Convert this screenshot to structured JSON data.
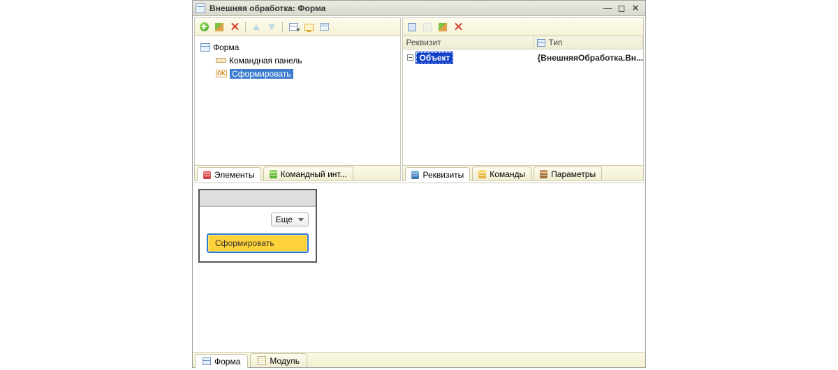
{
  "window": {
    "title": "Внешняя обработка: Форма"
  },
  "left_pane": {
    "tree": {
      "root": "Форма",
      "cmd_panel": "Командная панель",
      "generate": "Сформировать"
    },
    "tabs": {
      "elements": "Элементы",
      "cmd_interface": "Командный инт..."
    }
  },
  "right_pane": {
    "columns": {
      "attr": "Реквизит",
      "type": "Тип"
    },
    "row": {
      "name": "Объект",
      "type": "{ВнешняяОбработка.Вн..."
    },
    "tabs": {
      "attrs": "Реквизиты",
      "commands": "Команды",
      "params": "Параметры"
    }
  },
  "preview": {
    "more": "Еще",
    "generate": "Сформировать"
  },
  "bottom_tabs": {
    "form": "Форма",
    "module": "Модуль"
  },
  "ok_badge": "OK"
}
